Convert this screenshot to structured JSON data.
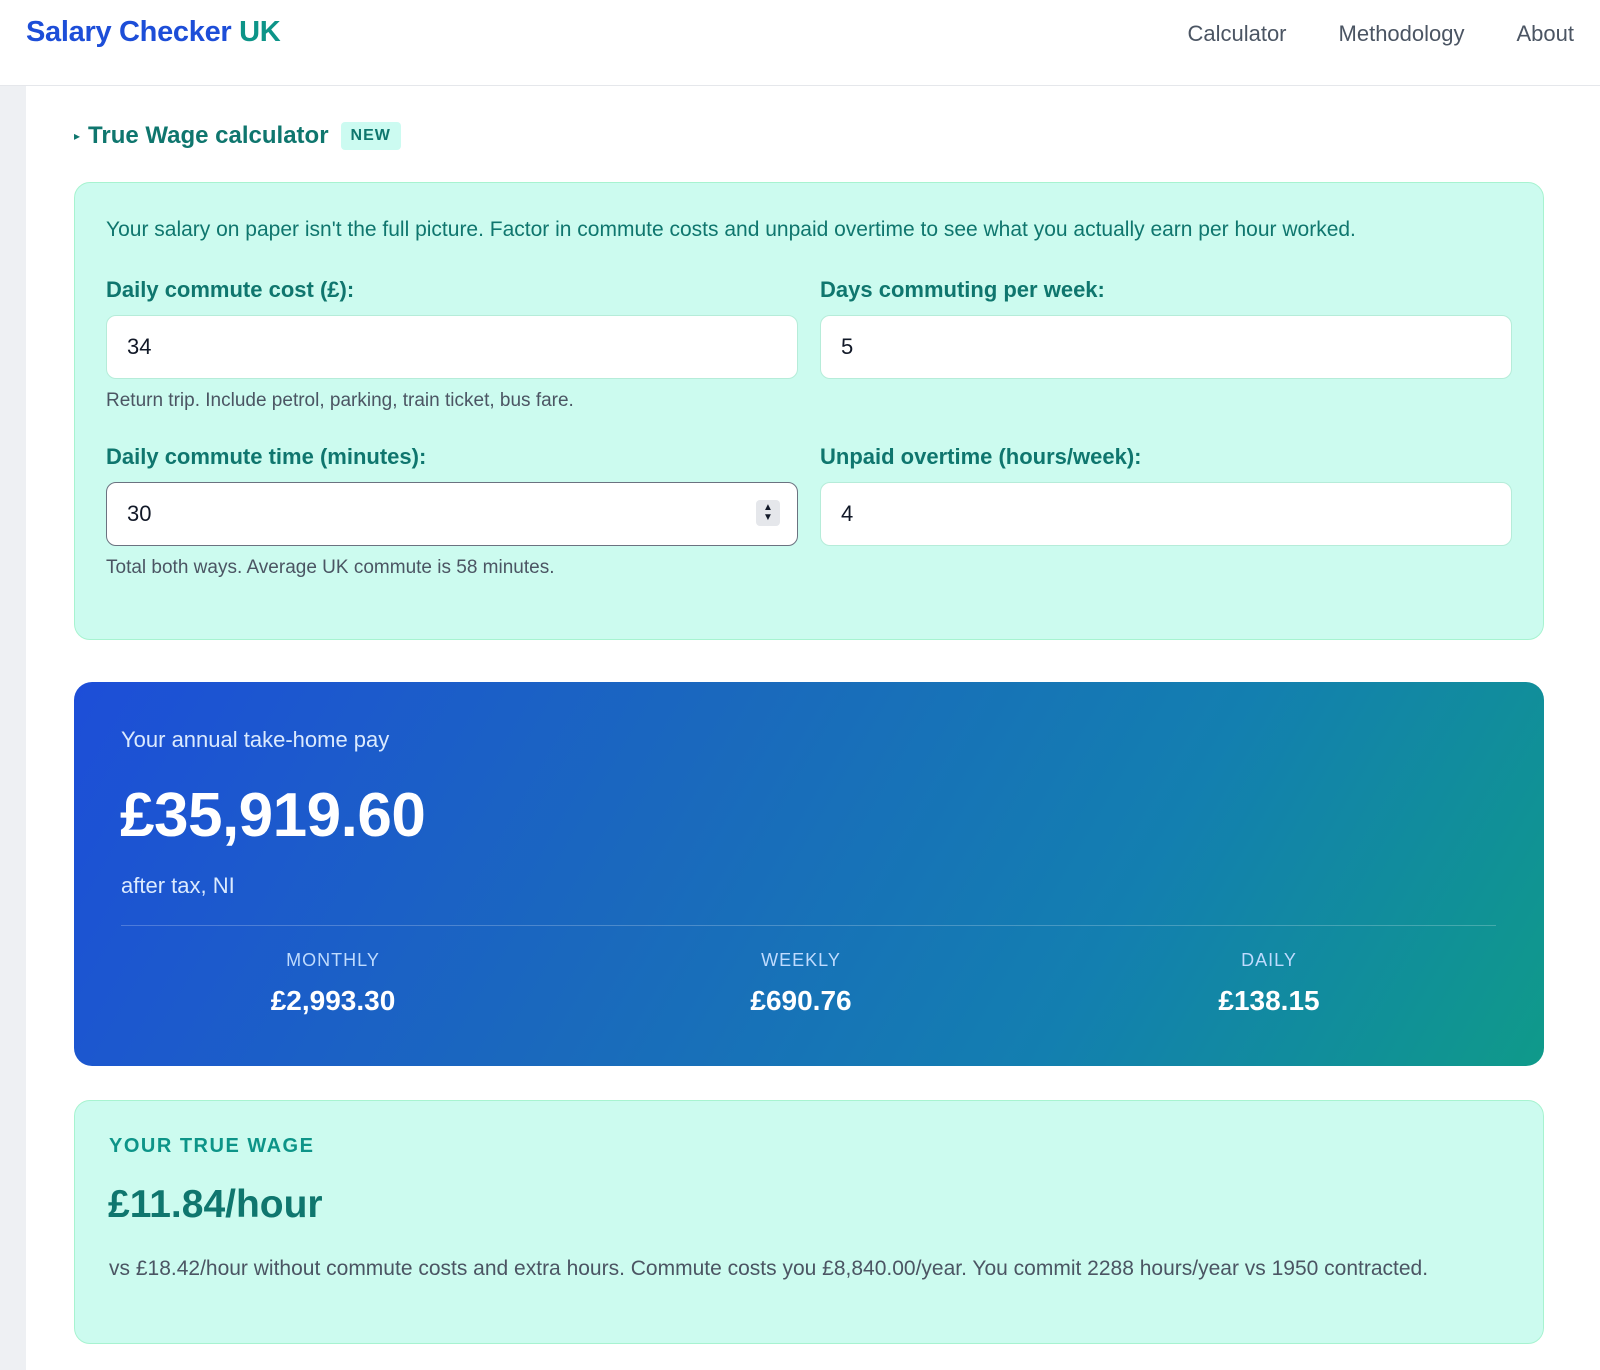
{
  "header": {
    "brand_main": "Salary Checker",
    "brand_accent": "UK",
    "nav": [
      "Calculator",
      "Methodology",
      "About"
    ]
  },
  "true_wage_section": {
    "toggle_label": "True Wage calculator",
    "badge": "NEW",
    "intro": "Your salary on paper isn't the full picture. Factor in commute costs and unpaid overtime to see what you actually earn per hour worked.",
    "fields": {
      "commute_cost": {
        "label": "Daily commute cost (£):",
        "value": "34",
        "hint": "Return trip. Include petrol, parking, train ticket, bus fare."
      },
      "days_per_week": {
        "label": "Days commuting per week:",
        "value": "5"
      },
      "commute_time": {
        "label": "Daily commute time (minutes):",
        "value": "30",
        "hint": "Total both ways. Average UK commute is 58 minutes."
      },
      "overtime": {
        "label": "Unpaid overtime (hours/week):",
        "value": "4"
      }
    }
  },
  "result": {
    "label": "Your annual take-home pay",
    "amount": "£35,919.60",
    "sub": "after tax, NI",
    "stats": [
      {
        "label": "MONTHLY",
        "value": "£2,993.30"
      },
      {
        "label": "WEEKLY",
        "value": "£690.76"
      },
      {
        "label": "DAILY",
        "value": "£138.15"
      }
    ]
  },
  "true_wage": {
    "label": "YOUR TRUE WAGE",
    "value": "£11.84/hour",
    "description": "vs £18.42/hour without commute costs and extra hours. Commute costs you £8,840.00/year. You commit 2288 hours/year vs 1950 contracted."
  },
  "colors": {
    "brand_blue": "#1d4ed8",
    "brand_teal": "#0d9488",
    "card_mint": "#ccfbef",
    "gradient_start": "#1d4ed8",
    "gradient_end": "#0f9a8a"
  }
}
